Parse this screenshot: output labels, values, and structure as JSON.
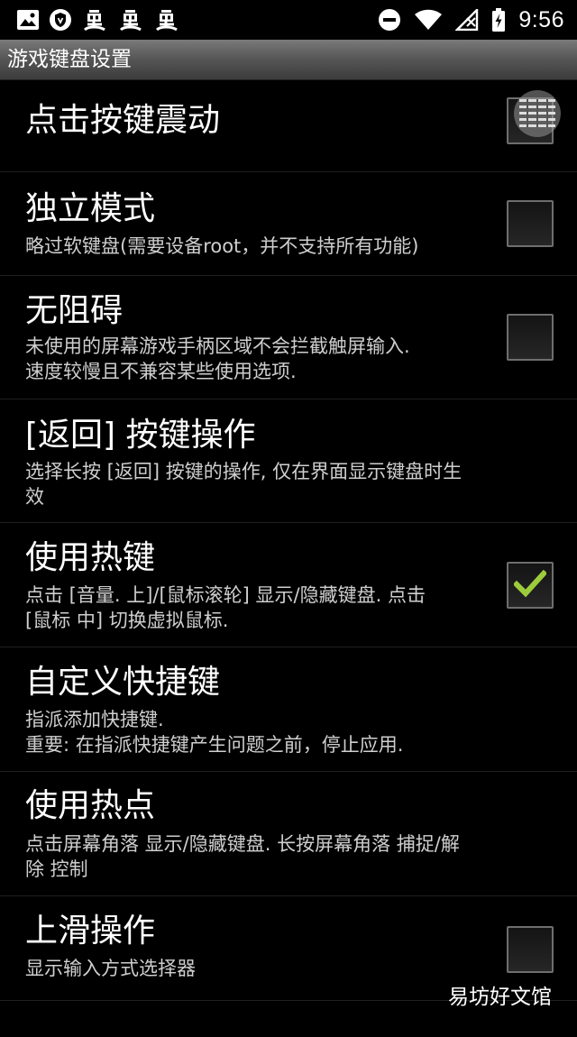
{
  "status_bar": {
    "time": "9:56",
    "left_icons": [
      "image-icon",
      "shield-icon",
      "bug-icon",
      "bug-icon",
      "bug-icon"
    ],
    "right_icons": [
      "do-not-disturb-icon",
      "wifi-icon",
      "no-signal-icon",
      "battery-charging-icon"
    ]
  },
  "title_bar": {
    "title": "游戏键盘设置"
  },
  "settings": [
    {
      "title": "点击按键震动",
      "summary": [],
      "checkbox": true,
      "checked": false
    },
    {
      "title": "独立模式",
      "summary": [
        "略过软键盘(需要设备root，并不支持所有功能)"
      ],
      "checkbox": true,
      "checked": false
    },
    {
      "title": "无阻碍",
      "summary": [
        "未使用的屏幕游戏手柄区域不会拦截触屏输入.",
        "速度较慢且不兼容某些使用选项."
      ],
      "checkbox": true,
      "checked": false
    },
    {
      "title": "[返回] 按键操作",
      "summary": [
        "选择长按 [返回] 按键的操作, 仅在界面显示键盘时生",
        "效"
      ],
      "checkbox": false,
      "checked": false
    },
    {
      "title": "使用热键",
      "summary": [
        "点击 [音量. 上]/[鼠标滚轮] 显示/隐藏键盘. 点击",
        "[鼠标 中] 切换虚拟鼠标."
      ],
      "checkbox": true,
      "checked": true
    },
    {
      "title": "自定义快捷键",
      "summary": [
        "指派添加快捷键.",
        "重要: 在指派快捷键产生问题之前，停止应用."
      ],
      "checkbox": false,
      "checked": false
    },
    {
      "title": "使用热点",
      "summary": [
        "点击屏幕角落 显示/隐藏键盘. 长按屏幕角落 捕捉/解",
        "除 控制"
      ],
      "checkbox": false,
      "checked": false
    },
    {
      "title": "上滑操作",
      "summary": [
        "显示输入方式选择器"
      ],
      "checkbox": true,
      "checked": false
    }
  ],
  "watermark": "易坊好文馆",
  "colors": {
    "check_mark": "#9ccc3c",
    "summary_text": "#cfcfcf",
    "divider": "#1f1f1f"
  }
}
